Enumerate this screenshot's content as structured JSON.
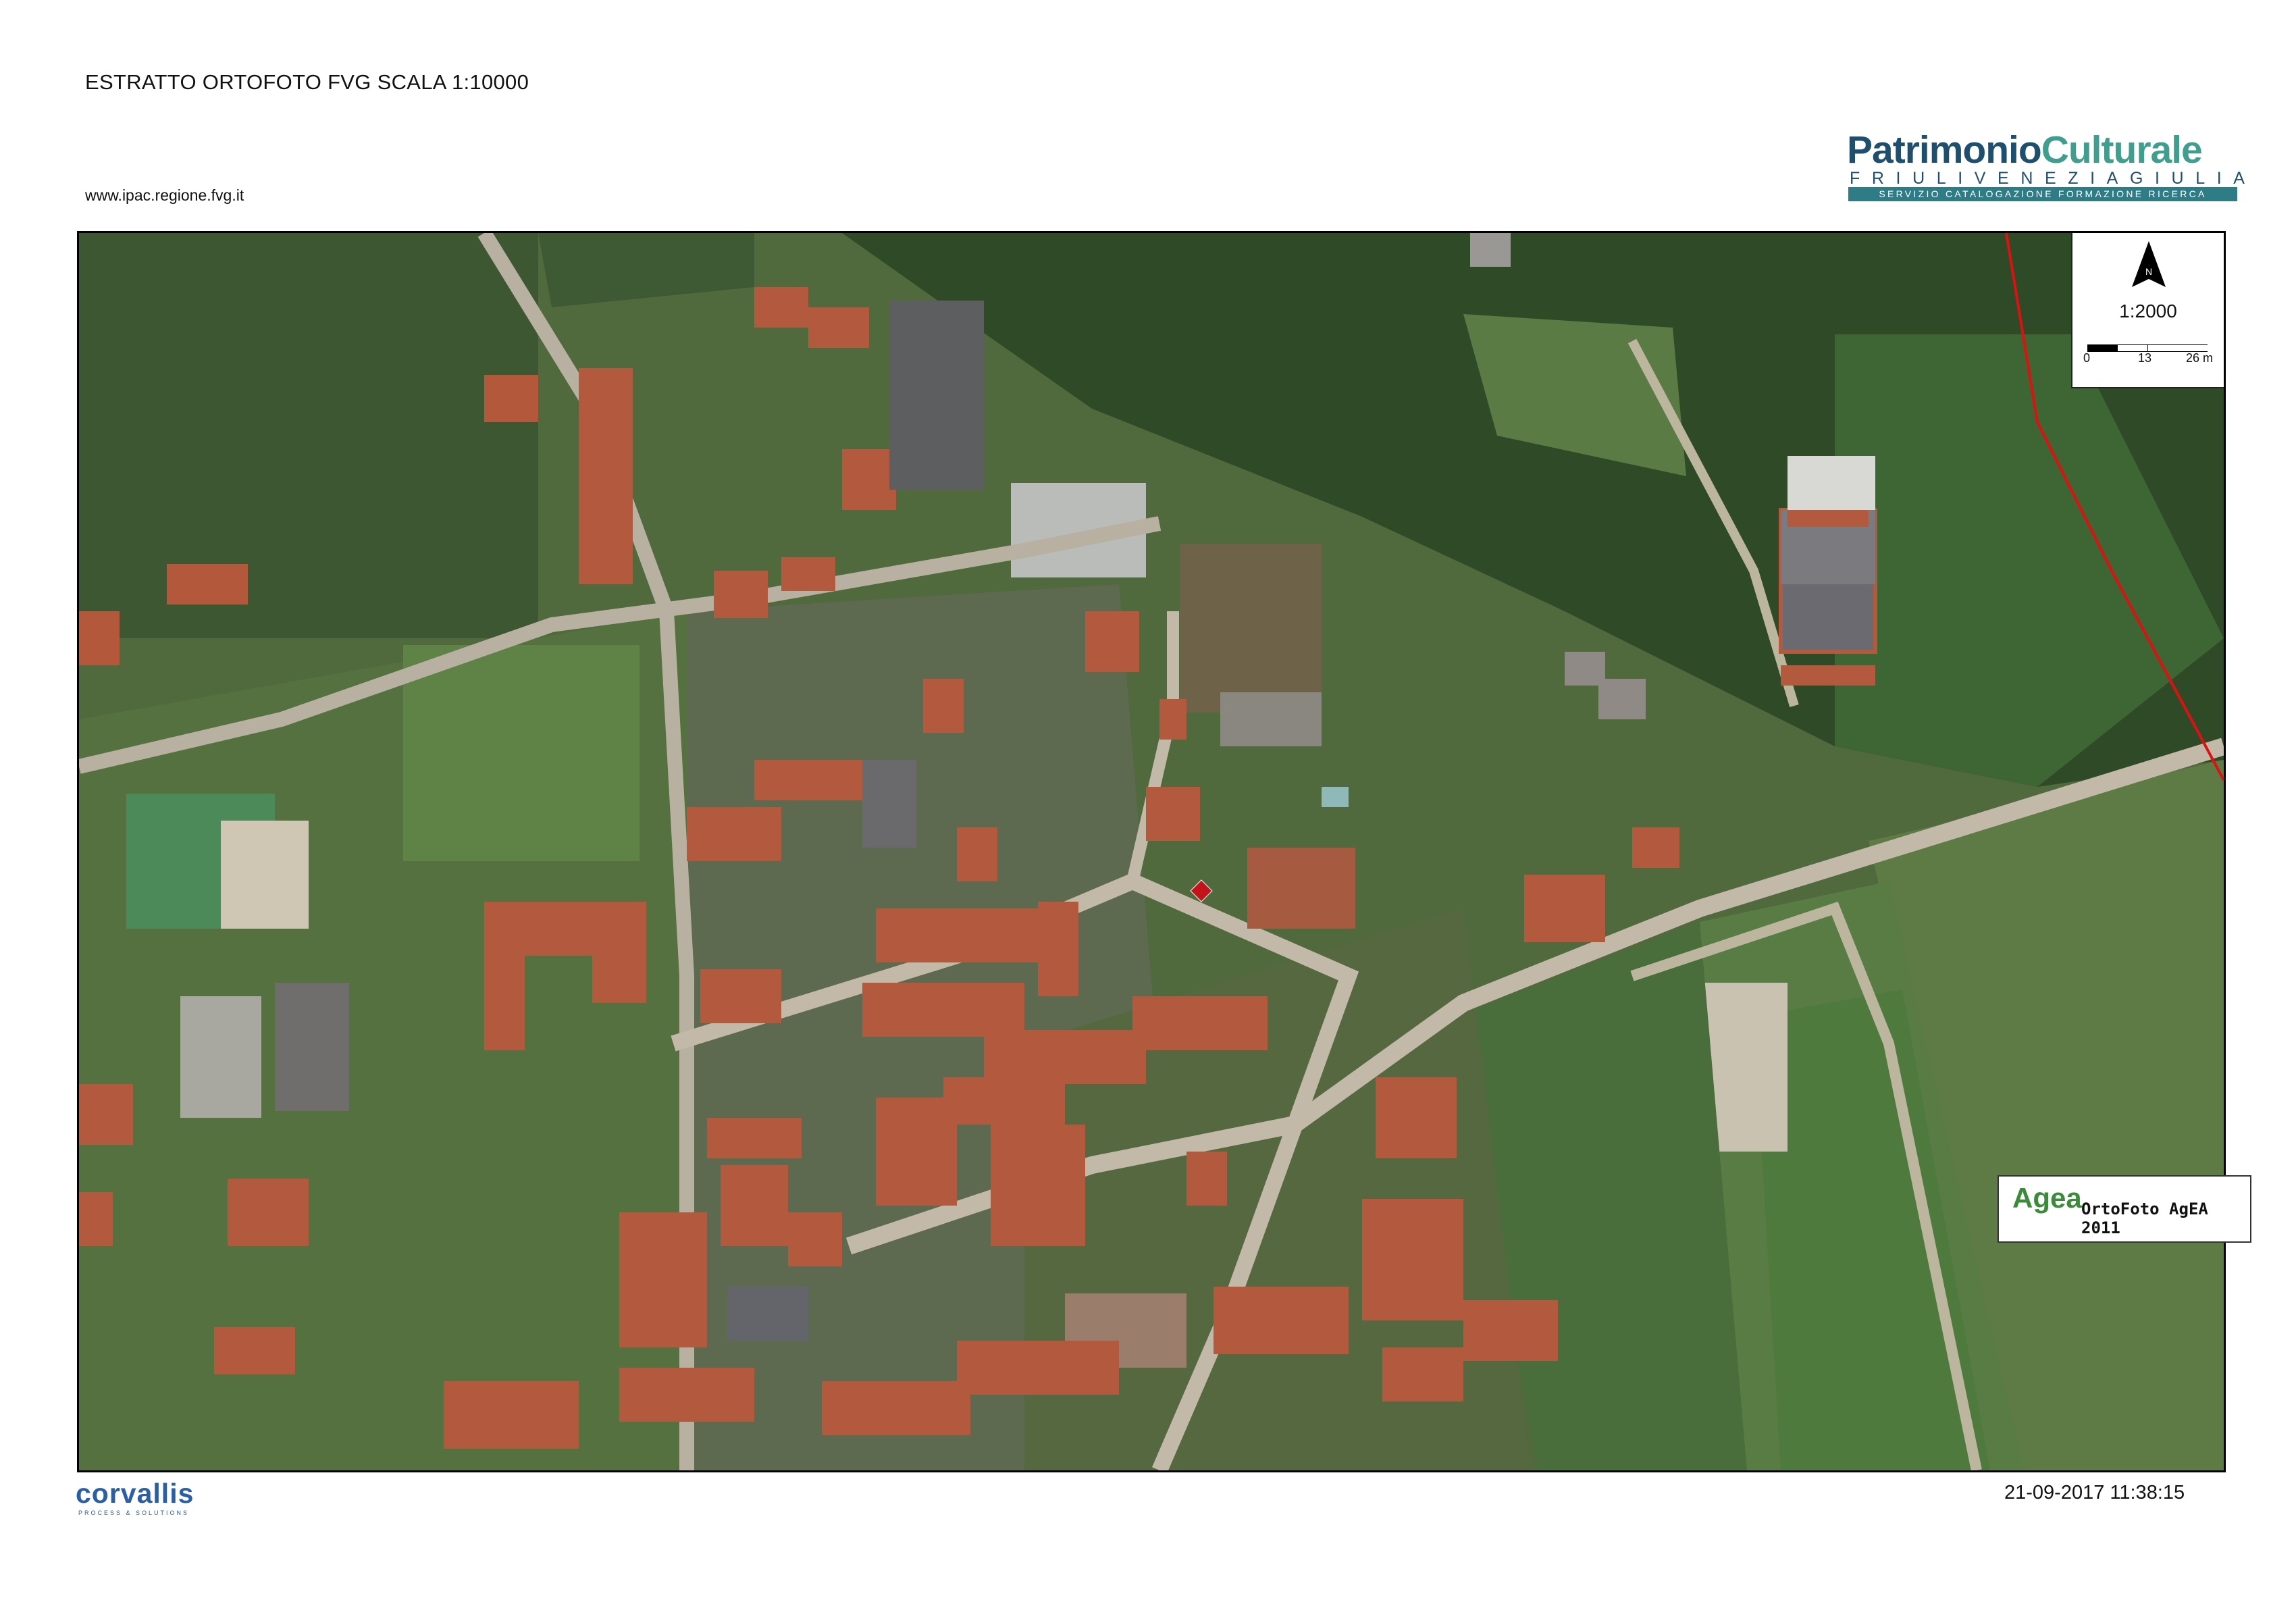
{
  "header": {
    "title": "ESTRATTO ORTOFOTO FVG SCALA 1:10000",
    "url": "www.ipac.regione.fvg.it"
  },
  "logo": {
    "word1": "Patrimonio",
    "word2": "Culturale",
    "region": "FRIULIVENEZIAGIULIA",
    "service": "SERVIZIO CATALOGAZIONE FORMAZIONE RICERCA"
  },
  "map": {
    "north_label": "N",
    "scale": "1:2000",
    "scale_bar_ticks": [
      "0",
      "13",
      "26 m"
    ],
    "source_logo": "Agea",
    "source_label": "OrtoFoto AgEA 2011",
    "marker": "red-diamond",
    "icons": [
      "north-arrow-icon",
      "location-marker-icon"
    ]
  },
  "footer": {
    "timestamp": "21-09-2017 11:38:15",
    "company": "corvallis",
    "company_tagline": "PROCESS & SOLUTIONS"
  },
  "colors": {
    "marker": "#c4141b",
    "boundary_line": "#e01010",
    "logo_dark": "#1f4f6e",
    "logo_teal": "#3f9e8e"
  }
}
